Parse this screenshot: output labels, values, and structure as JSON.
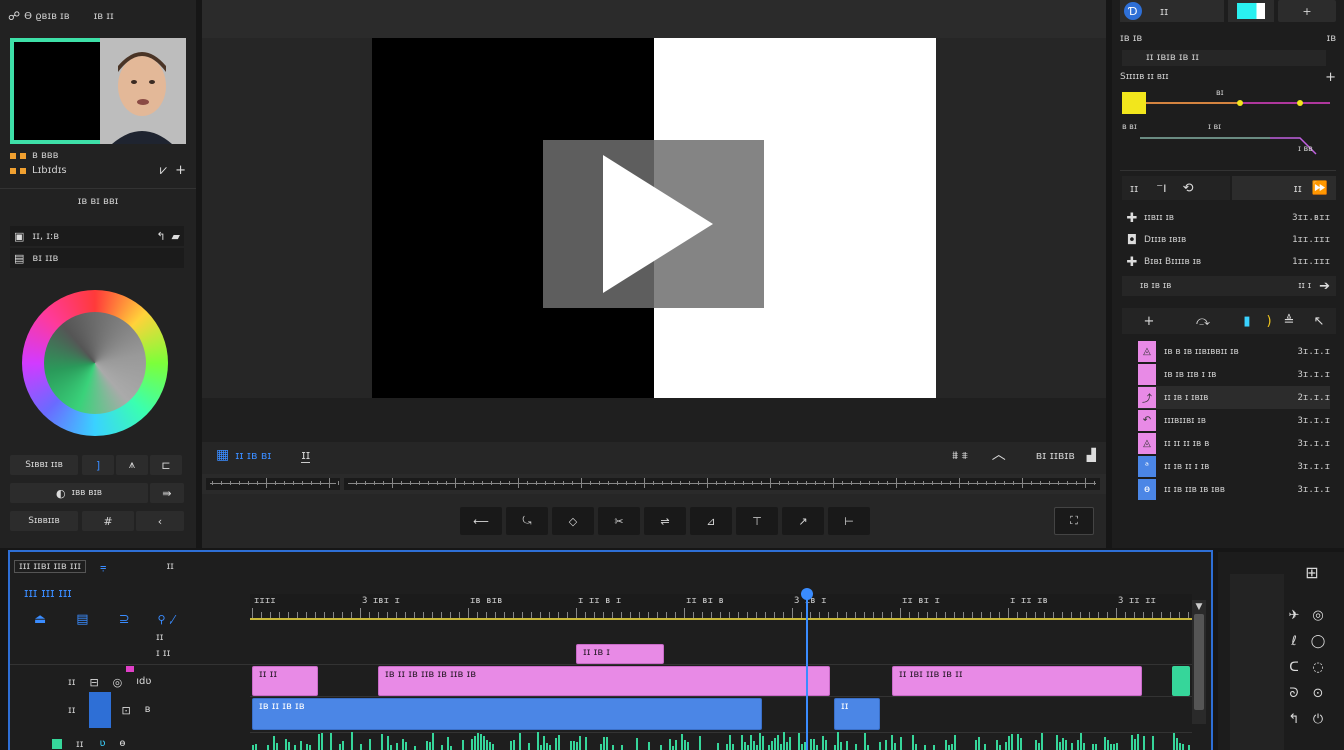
{
  "left": {
    "header_left": "Ɵ ϱʙɪʙ ɪʙ",
    "header_right": "ɪʙ ɪɪ",
    "media_labels": [
      "ʙ ʙʙʙ",
      "Lɪbɪdɪs"
    ],
    "section_title": "ɪʙ ʙɪ ʙʙɪ",
    "field_1": "ɪɪ, ɪ:ʙ",
    "field_2": "ʙɪ ɪɪʙ",
    "tool_row_1_label": "Sɪʙʙɪ ɪɪʙ",
    "tool_row_2_label": "ɪʙʙ ʙɪʙ",
    "tool_row_3_label": "Sɪʙʙɪɪʙ"
  },
  "viewer": {
    "tab_label": "ɪɪ ɪʙ ʙɪ",
    "tab_icon_label": "ɪɪ",
    "right_label": "ʙɪ ɪɪʙɪʙ"
  },
  "right": {
    "top_label": "ɪɪ",
    "section_1": "ɪʙ ɪʙ",
    "section_1_right": "ɪʙ",
    "sub_1": "ɪɪ ɪʙɪʙ ɪʙ ɪɪ",
    "section_2": "Sɪɪɪɪʙ ɪɪ ʙɪɪ",
    "graph_labels": [
      "ʙɪ",
      "ʙ ʙɪ",
      "ɪ ʙɪ",
      "ɪ ʙʙ",
      "ɪ ʙʙ"
    ],
    "tc_left": "ɪɪ",
    "tc_right": "ɪɪ",
    "params": [
      {
        "label": "ɪɪʙɪɪ ɪʙ",
        "value": "3ɪɪ.ʙɪɪ"
      },
      {
        "label": "Dɪɪɪʙ ɪʙɪʙ",
        "value": "1ɪɪ.ɪɪɪ"
      },
      {
        "label": "Bɪʙɪ Bɪɪɪɪʙ ɪʙ",
        "value": "1ɪɪ.ɪɪɪ"
      }
    ],
    "dropdown_label": "ɪʙ ɪʙ ɪʙ",
    "dropdown_value": "ɪɪ ɪ",
    "list": [
      {
        "label": "ɪʙ ʙ ɪʙ ɪɪʙɪʙʙɪɪ ɪʙ",
        "value": "3ɪ.ɪ.ɪ",
        "color": "#e88ae6"
      },
      {
        "label": "ɪʙ ɪʙ ɪɪʙ ɪ ɪʙ",
        "value": "3ɪ.ɪ.ɪ",
        "color": "#e88ae6"
      },
      {
        "label": "ɪɪ ɪʙ ɪ ɪʙɪʙ",
        "value": "2ɪ.ɪ.ɪ",
        "color": "#e88ae6"
      },
      {
        "label": "ɪɪɪʙɪɪʙɪ ɪʙ",
        "value": "3ɪ.ɪ.ɪ",
        "color": "#e88ae6"
      },
      {
        "label": "ɪɪ ɪɪ ɪɪ ɪʙ ʙ",
        "value": "3ɪ.ɪ.ɪ",
        "color": "#e88ae6"
      },
      {
        "label": "ɪɪ ɪʙ ɪɪ ɪ ɪʙ",
        "value": "3ɪ.ɪ.ɪ",
        "color": "#4b86e6"
      },
      {
        "label": "ɪɪ ɪʙ ɪɪʙ ɪʙ ɪʙʙ",
        "value": "3ɪ.ɪ.ɪ",
        "color": "#4b86e6"
      }
    ]
  },
  "timeline": {
    "title": "ɪɪɪ ɪɪʙɪ ɪɪʙ ɪɪɪ",
    "title_right": "ɪɪ",
    "sub_title": "ɪɪɪ ɪɪɪ ɪɪɪ",
    "track_info_1": "ɪɪ",
    "track_info_2": "ɪ ɪɪ",
    "timecodes": [
      "ɪɪɪɪ",
      "3 ɪʙɪ ɪ",
      "ɪʙ ʙɪʙ",
      "ɪ ɪɪ ʙ ɪ",
      "ɪɪ ʙɪ ʙ",
      "3 ɪʙ ɪ",
      "ɪɪ ʙɪ ɪ",
      "ɪ ɪɪ ɪʙ",
      "3 ɪɪ ɪɪ"
    ],
    "track_labels": [
      "ɪɪ",
      "ɪɪ",
      "ɪɪ"
    ],
    "clip_1": "ɪɪ ɪʙ ɪ",
    "clip_2": "ɪʙ ɪɪ ɪʙ ɪɪʙ ɪʙ ɪɪʙ ɪʙ",
    "clip_3": "ɪɪ ɪʙɪ ɪɪʙ ɪʙ ɪɪ",
    "clip_4": "ɪʙ ɪɪ ɪʙ ɪʙ"
  },
  "colors": {
    "accent_blue": "#2e6fd6",
    "clip_pink": "#e88ae6",
    "clip_blue": "#4b86e6",
    "audio_green": "#36d69a",
    "playhead": "#3a8cff"
  }
}
